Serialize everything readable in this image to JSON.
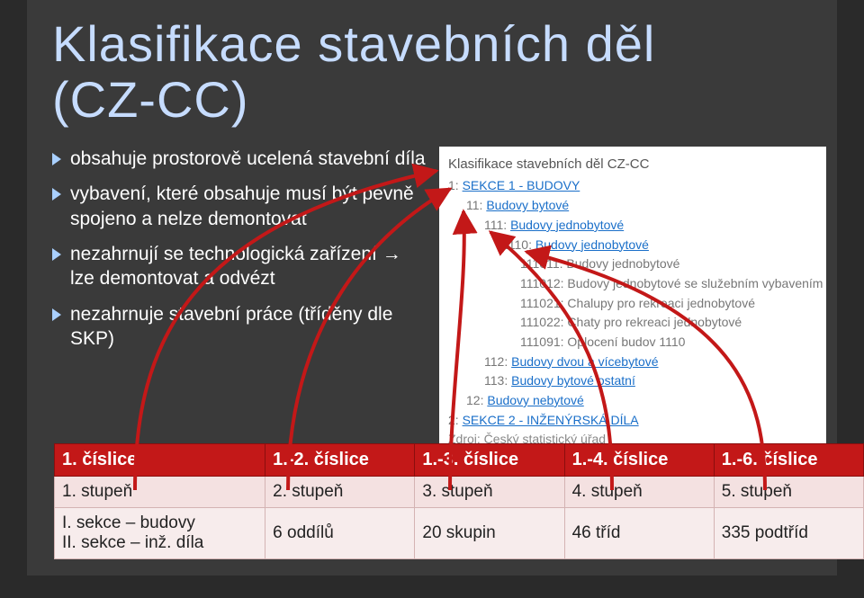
{
  "title_line1": "Klasifikace stavebních děl",
  "title_line2": "(CZ-CC)",
  "bullets": [
    "obsahuje prostorově ucelená stavební díla",
    "vybavení, které obsahuje musí být pevně spojeno a nelze demontovat",
    "nezahrnují se technologická zařízení → lze demontovat a odvézt",
    "nezahrnuje stavební práce (tříděny dle SKP)"
  ],
  "tree": {
    "heading": "Klasifikace stavebních děl CZ-CC",
    "sec1_num": "1:",
    "sec1_label": "SEKCE 1 - BUDOVY",
    "l11_num": "11:",
    "l11_label": "Budovy bytové",
    "l111_num": "111:",
    "l111_label": "Budovy jednobytové",
    "l1110_num": "1110:",
    "l1110_label": "Budovy jednobytové",
    "leaf_111011": "111011:  Budovy jednobytové",
    "leaf_111012": "111012:  Budovy jednobytové se služebním vybavením",
    "leaf_111021": "111021:  Chalupy pro rekreaci jednobytové",
    "leaf_111022": "111022:  Chaty pro rekreaci jednobytové",
    "leaf_111091": "111091:  Oplocení budov 1110",
    "l112_num": "112:",
    "l112_label": "Budovy dvou a vícebytové",
    "l113_num": "113:",
    "l113_label": "Budovy bytové ostatní",
    "l12_num": "12:",
    "l12_label": "Budovy nebytové",
    "sec2_num": "2:",
    "sec2_label": "SEKCE 2 - INŽENÝRSKÁ DÍLA",
    "source": "Zdroj: Český statistický úřad"
  },
  "table": {
    "h1": "1. číslice",
    "h2": "1.-2. číslice",
    "h3": "1.-3. číslice",
    "h4": "1.-4. číslice",
    "h5": "1.-6. číslice",
    "r1c1": "1. stupeň",
    "r1c2": "2. stupeň",
    "r1c3": "3. stupeň",
    "r1c4": "4. stupeň",
    "r1c5": "5. stupeň",
    "r2c1a": "I.   sekce – budovy",
    "r2c1b": "II.  sekce – inž. díla",
    "r2c2": "6 oddílů",
    "r2c3": "20 skupin",
    "r2c4": "46 tříd",
    "r2c5": "335 podtříd"
  }
}
